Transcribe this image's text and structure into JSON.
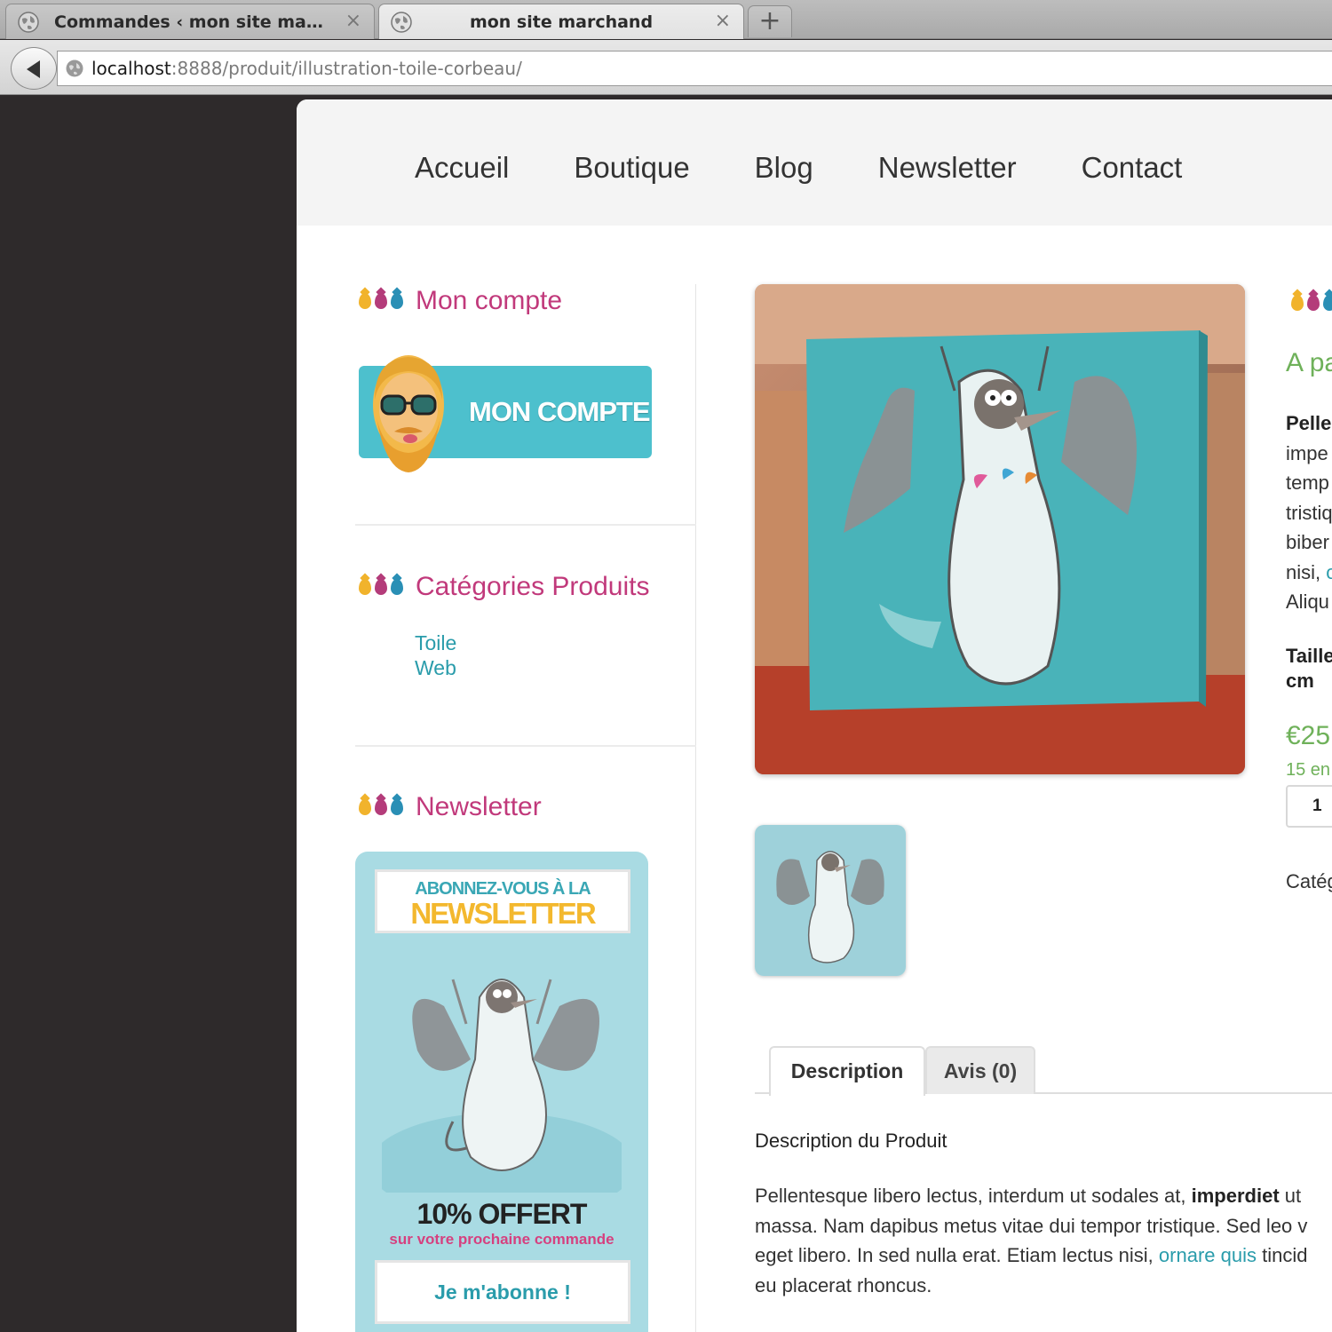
{
  "browser": {
    "tabs": [
      {
        "title": "Commandes ‹ mon site marcha…",
        "active": false
      },
      {
        "title": "mon site marchand",
        "active": true
      }
    ],
    "close_glyph": "×",
    "new_tab_glyph": "+",
    "url_host": "localhost",
    "url_rest": ":8888/produit/illustration-toile-corbeau/"
  },
  "nav": {
    "items": [
      "Accueil",
      "Boutique",
      "Blog",
      "Newsletter",
      "Contact"
    ]
  },
  "sidebar": {
    "account": {
      "title": "Mon compte",
      "banner_label": "MON COMPTE"
    },
    "categories": {
      "title": "Catégories Produits",
      "items": [
        "Toile",
        "Web"
      ]
    },
    "newsletter": {
      "title": "Newsletter",
      "line1": "ABONNEZ-VOUS À LA",
      "line2": "NEWSLETTER",
      "offer": "10% OFFERT",
      "offer_sub": "sur votre prochaine commande",
      "button": "Je m'abonne !"
    }
  },
  "summary": {
    "title_partial": "A pa",
    "desc_lines": [
      "Pelle",
      "impe",
      "temp",
      "tristiq",
      "biber",
      "nisi,",
      "Aliqu"
    ],
    "desc_link_partial": "o",
    "size_line1": "Taille",
    "size_line2": "cm",
    "price_partial": "€25",
    "stock_partial": "15 en",
    "quantity": "1",
    "category_partial": "Catég"
  },
  "product_tabs": {
    "description": "Description",
    "reviews": "Avis (0)"
  },
  "description": {
    "heading": "Description du Produit",
    "line1_a": "Pellentesque libero lectus, interdum ut sodales at, ",
    "line1_bold": "imperdiet",
    "line1_b": " ut",
    "line2": "massa. Nam dapibus metus vitae dui tempor tristique. Sed leo v",
    "line3_a": "eget libero. In sed nulla erat. Etiam lectus nisi, ",
    "line3_link": "ornare quis",
    "line3_b": " tincid",
    "line4": "eu placerat rhoncus."
  },
  "colors": {
    "accent_pink": "#c1397b",
    "accent_teal": "#2a9cab",
    "price_green": "#6fb15a",
    "banner_teal": "#4dc0cd",
    "dark_bg": "#2e2a2b"
  },
  "icons": {
    "tab_favicon": "globe-icon",
    "back": "back-arrow-icon",
    "title_bullets": "ink-drops-icon"
  }
}
